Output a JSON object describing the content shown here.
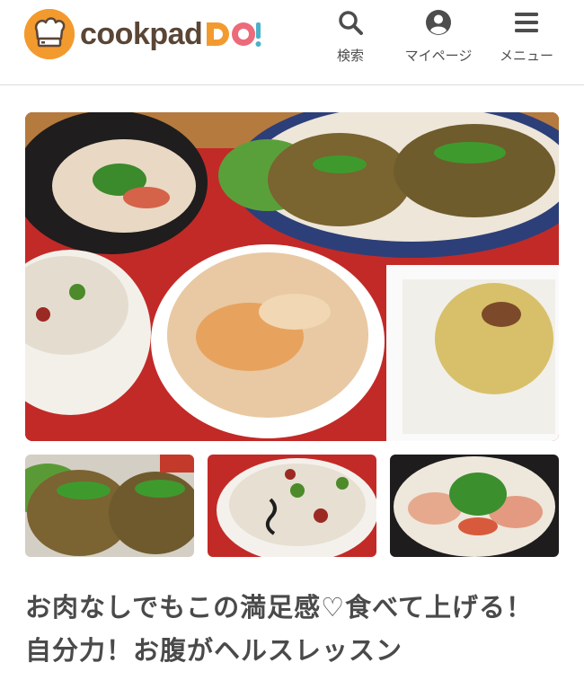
{
  "header": {
    "logo": {
      "wordmark": "cookpad",
      "do_mark": "DO!"
    },
    "nav": [
      {
        "label": "検索",
        "icon": "search-icon"
      },
      {
        "label": "マイページ",
        "icon": "user-icon"
      },
      {
        "label": "メニュー",
        "icon": "menu-icon"
      }
    ]
  },
  "media": {
    "hero_icon": "food-photo",
    "thumbnails": [
      {
        "icon": "hamburg-steak-photo"
      },
      {
        "icon": "mixed-rice-photo"
      },
      {
        "icon": "radish-salad-photo"
      }
    ]
  },
  "article": {
    "title": "お肉なしでもこの満足感♡食べて上げる！自分力！お腹がヘルスレッスン"
  },
  "colors": {
    "brand_orange": "#f39a2e",
    "brand_pink": "#ec6a7a",
    "brand_blue": "#4bb1c9",
    "logo_brown": "#5a4636",
    "text": "#4a4a4a"
  }
}
